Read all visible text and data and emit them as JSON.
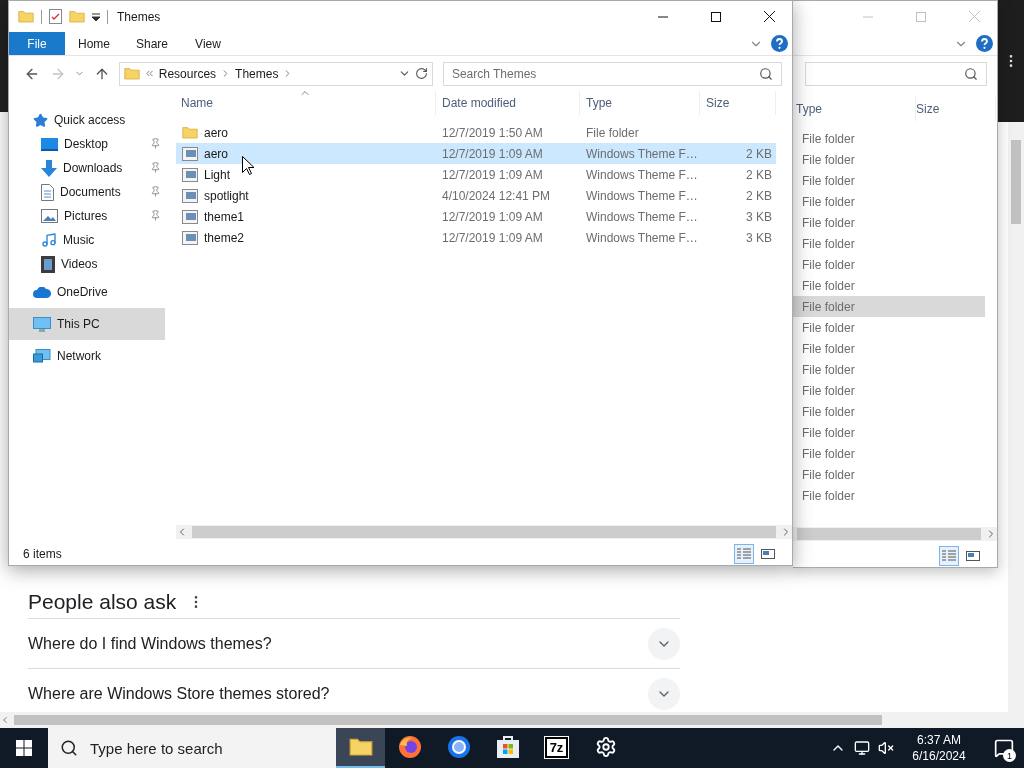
{
  "browser": {
    "section_title": "People also ask",
    "questions": [
      "Where do I find Windows themes?",
      "Where are Windows Store themes stored?"
    ]
  },
  "back_window": {
    "columns": [
      "Type",
      "Size"
    ],
    "rows": [
      {
        "type": "File folder",
        "selected": false
      },
      {
        "type": "File folder",
        "selected": false
      },
      {
        "type": "File folder",
        "selected": false
      },
      {
        "type": "File folder",
        "selected": false
      },
      {
        "type": "File folder",
        "selected": false
      },
      {
        "type": "File folder",
        "selected": false
      },
      {
        "type": "File folder",
        "selected": false
      },
      {
        "type": "File folder",
        "selected": false
      },
      {
        "type": "File folder",
        "selected": true
      },
      {
        "type": "File folder",
        "selected": false
      },
      {
        "type": "File folder",
        "selected": false
      },
      {
        "type": "File folder",
        "selected": false
      },
      {
        "type": "File folder",
        "selected": false
      },
      {
        "type": "File folder",
        "selected": false
      },
      {
        "type": "File folder",
        "selected": false
      },
      {
        "type": "File folder",
        "selected": false
      },
      {
        "type": "File folder",
        "selected": false
      },
      {
        "type": "File folder",
        "selected": false
      }
    ]
  },
  "explorer": {
    "title": "Themes",
    "ribbon_tabs": [
      {
        "label": "File",
        "selected": true
      },
      {
        "label": "Home",
        "selected": false
      },
      {
        "label": "Share",
        "selected": false
      },
      {
        "label": "View",
        "selected": false
      }
    ],
    "breadcrumb": [
      "Resources",
      "Themes"
    ],
    "search": {
      "placeholder": "Search Themes"
    },
    "nav": [
      {
        "label": "Quick access",
        "kind": "star",
        "selected": false,
        "children": [
          {
            "label": "Desktop",
            "kind": "desktop",
            "pinned": true,
            "selected": false
          },
          {
            "label": "Downloads",
            "kind": "downloads",
            "pinned": true,
            "selected": false
          },
          {
            "label": "Documents",
            "kind": "documents",
            "pinned": true,
            "selected": false
          },
          {
            "label": "Pictures",
            "kind": "pictures",
            "pinned": true,
            "selected": false
          },
          {
            "label": "Music",
            "kind": "music",
            "pinned": false,
            "selected": false
          },
          {
            "label": "Videos",
            "kind": "videos",
            "pinned": false,
            "selected": false
          }
        ]
      },
      {
        "label": "OneDrive",
        "kind": "onedrive",
        "selected": false
      },
      {
        "label": "This PC",
        "kind": "pc",
        "selected": true
      },
      {
        "label": "Network",
        "kind": "network",
        "selected": false
      }
    ],
    "columns": [
      "Name",
      "Date modified",
      "Type",
      "Size"
    ],
    "files": [
      {
        "name": "aero",
        "date": "12/7/2019 1:50 AM",
        "type": "File folder",
        "kind": "folder",
        "selected": false
      },
      {
        "name": "aero",
        "date": "12/7/2019 1:09 AM",
        "type": "Windows Theme F…",
        "size": "2 KB",
        "kind": "theme",
        "selected": true
      },
      {
        "name": "Light",
        "date": "12/7/2019 1:09 AM",
        "type": "Windows Theme F…",
        "size": "2 KB",
        "kind": "theme",
        "selected": false
      },
      {
        "name": "spotlight",
        "date": "4/10/2024 12:41 PM",
        "type": "Windows Theme F…",
        "size": "2 KB",
        "kind": "theme",
        "selected": false
      },
      {
        "name": "theme1",
        "date": "12/7/2019 1:09 AM",
        "type": "Windows Theme F…",
        "size": "3 KB",
        "kind": "theme",
        "selected": false
      },
      {
        "name": "theme2",
        "date": "12/7/2019 1:09 AM",
        "type": "Windows Theme F…",
        "size": "3 KB",
        "kind": "theme",
        "selected": false
      }
    ],
    "status": "6 items"
  },
  "taskbar": {
    "search_placeholder": "Type here to search",
    "apps": [
      {
        "kind": "explorer",
        "active": true
      },
      {
        "kind": "firefox",
        "active": false
      },
      {
        "kind": "browser",
        "active": false
      },
      {
        "kind": "store",
        "active": false
      },
      {
        "kind": "archiver",
        "label": "7z",
        "active": false
      },
      {
        "kind": "settings",
        "active": false
      }
    ],
    "time": "6:37 AM",
    "date": "6/16/2024",
    "notifications": "1"
  }
}
